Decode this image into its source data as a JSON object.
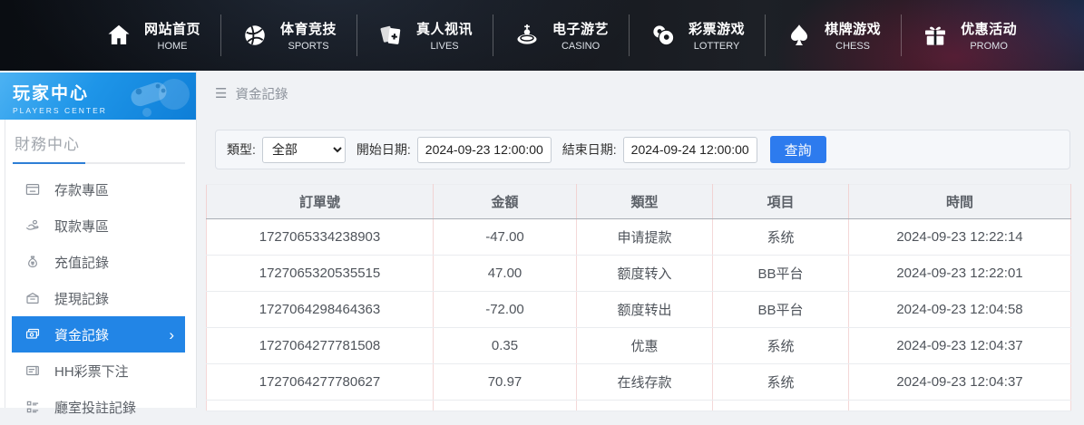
{
  "topnav": {
    "items": [
      {
        "key": "home",
        "zh": "网站首页",
        "en": "HOME",
        "icon": "home-icon"
      },
      {
        "key": "sports",
        "zh": "体育竞技",
        "en": "SPORTS",
        "icon": "sports-icon"
      },
      {
        "key": "lives",
        "zh": "真人视讯",
        "en": "LIVES",
        "icon": "cards-icon"
      },
      {
        "key": "casino",
        "zh": "电子游艺",
        "en": "CASINO",
        "icon": "roulette-icon"
      },
      {
        "key": "lottery",
        "zh": "彩票游戏",
        "en": "LOTTERY",
        "icon": "lottery-icon"
      },
      {
        "key": "chess",
        "zh": "棋牌游戏",
        "en": "CHESS",
        "icon": "spade-icon"
      },
      {
        "key": "promo",
        "zh": "优惠活动",
        "en": "PROMO",
        "icon": "gift-icon"
      }
    ]
  },
  "sidebar": {
    "title": "玩家中心",
    "subtitle": "PLAYERS CENTER",
    "section": "財務中心",
    "items": [
      {
        "key": "deposit-zone",
        "label": "存款專區",
        "icon": "deposit-icon",
        "active": false
      },
      {
        "key": "withdraw-zone",
        "label": "取款專區",
        "icon": "withdraw-icon",
        "active": false
      },
      {
        "key": "recharge-record",
        "label": "充值記錄",
        "icon": "recharge-icon",
        "active": false
      },
      {
        "key": "cashout-record",
        "label": "提現記錄",
        "icon": "cashout-icon",
        "active": false
      },
      {
        "key": "funds-record",
        "label": "資金記錄",
        "icon": "funds-icon",
        "active": true
      },
      {
        "key": "hh-lottery-bet",
        "label": "HH彩票下注",
        "icon": "lottery-bet-icon",
        "active": false
      },
      {
        "key": "hall-bet-record",
        "label": "廳室投註記錄",
        "icon": "hall-bet-icon",
        "active": false
      }
    ]
  },
  "breadcrumb": "資金記錄",
  "filter": {
    "type_label": "類型:",
    "type_value": "全部",
    "start_label": "開始日期:",
    "start_value": "2024-09-23 12:00:00",
    "end_label": "結束日期:",
    "end_value": "2024-09-24 12:00:00",
    "search_button": "查詢"
  },
  "table": {
    "headers": [
      "訂單號",
      "金額",
      "類型",
      "項目",
      "時間"
    ],
    "rows": [
      [
        "1727065334238903",
        "-47.00",
        "申请提款",
        "系统",
        "2024-09-23 12:22:14"
      ],
      [
        "1727065320535515",
        "47.00",
        "额度转入",
        "BB平台",
        "2024-09-23 12:22:01"
      ],
      [
        "1727064298464363",
        "-72.00",
        "额度转出",
        "BB平台",
        "2024-09-23 12:04:58"
      ],
      [
        "1727064277781508",
        "0.35",
        "优惠",
        "系统",
        "2024-09-23 12:04:37"
      ],
      [
        "1727064277780627",
        "70.97",
        "在线存款",
        "系统",
        "2024-09-23 12:04:37"
      ]
    ]
  },
  "colors": {
    "accent_blue": "#2285e6",
    "button_blue": "#2d7bee",
    "sidebar_header_top": "#4cb2f3",
    "sidebar_header_bottom": "#0e7ed7",
    "topbar_bg": "#14171d",
    "table_divider_pink": "#f2d2d2",
    "content_bg": "#f0f2f5"
  }
}
